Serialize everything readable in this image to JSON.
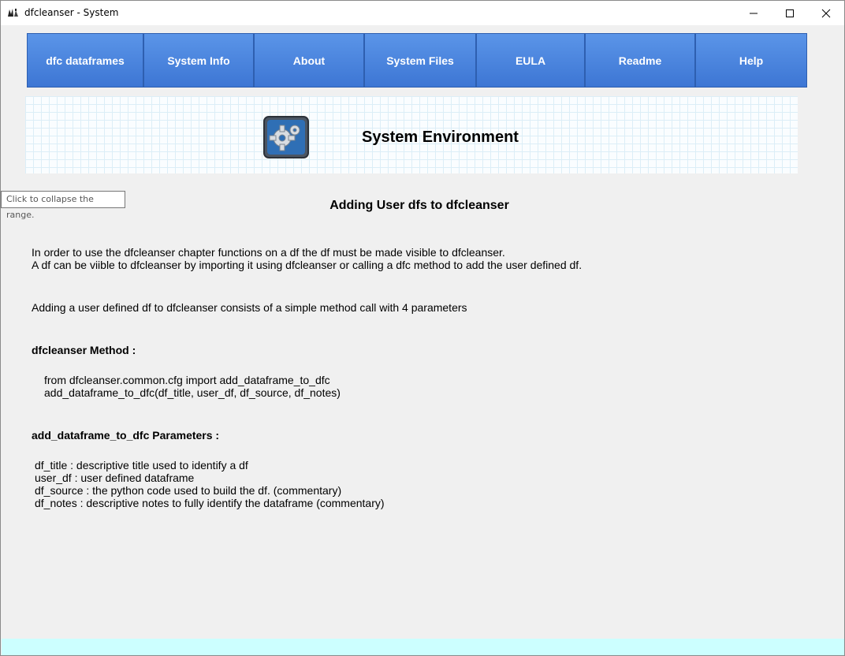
{
  "window": {
    "title": "dfcleanser - System"
  },
  "nav": {
    "tabs": [
      {
        "label": "dfc dataframes"
      },
      {
        "label": "System Info"
      },
      {
        "label": "About"
      },
      {
        "label": "System Files"
      },
      {
        "label": "EULA"
      },
      {
        "label": "Readme"
      },
      {
        "label": "Help"
      }
    ]
  },
  "banner": {
    "title": "System Environment",
    "icon": "gear-icon"
  },
  "tooltip": {
    "text": "Click to collapse the range."
  },
  "content": {
    "heading": "Adding User dfs to dfcleanser",
    "intro_line1": "In order to use the dfcleanser chapter functions on a df the df must be made visible to dfcleanser.",
    "intro_line2": "A df can be viible to dfcleanser by importing it using dfcleanser or calling a dfc method to add the user defined df.",
    "summary": "Adding a user defined df to dfcleanser consists of a simple method call with 4 parameters",
    "method_heading": "dfcleanser Method :",
    "code_line1": "from dfcleanser.common.cfg import add_dataframe_to_dfc",
    "code_line2": "add_dataframe_to_dfc(df_title, user_df, df_source, df_notes)",
    "params_heading": "add_dataframe_to_dfc Parameters :",
    "param1": "df_title : descriptive title used to identify a df",
    "param2": "user_df : user defined dataframe",
    "param3": "df_source : the python code used to build the df. (commentary)",
    "param4": "df_notes : descriptive notes to fully identify the dataframe (commentary)"
  },
  "colors": {
    "nav_button": "#4a86e0",
    "status_strip": "#ccffff"
  }
}
